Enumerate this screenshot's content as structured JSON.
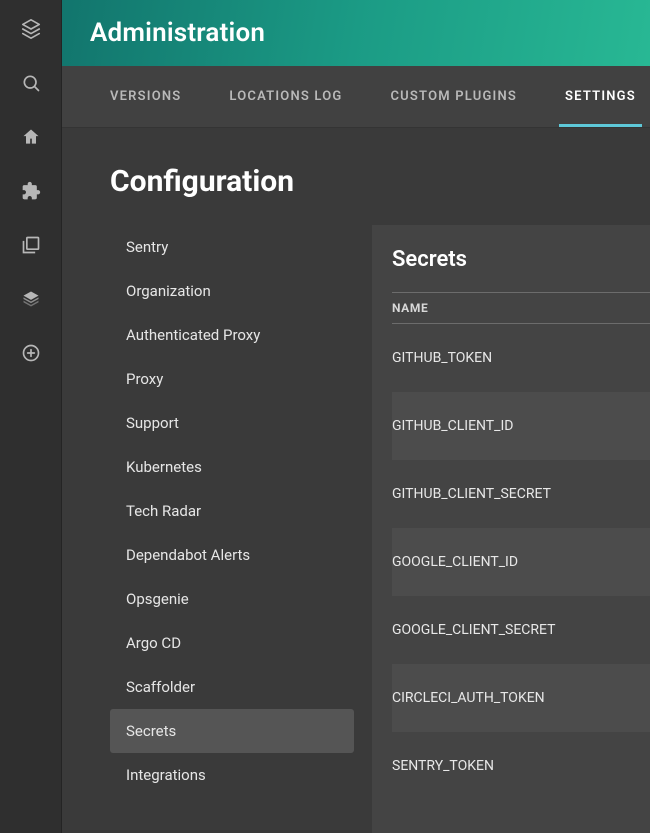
{
  "header": {
    "title": "Administration"
  },
  "tabs": [
    {
      "label": "VERSIONS",
      "active": false
    },
    {
      "label": "LOCATIONS LOG",
      "active": false
    },
    {
      "label": "CUSTOM PLUGINS",
      "active": false
    },
    {
      "label": "SETTINGS",
      "active": true
    }
  ],
  "page": {
    "title": "Configuration"
  },
  "sidenav": {
    "items": [
      {
        "label": "Sentry",
        "selected": false
      },
      {
        "label": "Organization",
        "selected": false
      },
      {
        "label": "Authenticated Proxy",
        "selected": false
      },
      {
        "label": "Proxy",
        "selected": false
      },
      {
        "label": "Support",
        "selected": false
      },
      {
        "label": "Kubernetes",
        "selected": false
      },
      {
        "label": "Tech Radar",
        "selected": false
      },
      {
        "label": "Dependabot Alerts",
        "selected": false
      },
      {
        "label": "Opsgenie",
        "selected": false
      },
      {
        "label": "Argo CD",
        "selected": false
      },
      {
        "label": "Scaffolder",
        "selected": false
      },
      {
        "label": "Secrets",
        "selected": true
      },
      {
        "label": "Integrations",
        "selected": false
      }
    ]
  },
  "secrets": {
    "title": "Secrets",
    "columns": {
      "name": "NAME"
    },
    "rows": [
      {
        "name": "GITHUB_TOKEN"
      },
      {
        "name": "GITHUB_CLIENT_ID"
      },
      {
        "name": "GITHUB_CLIENT_SECRET"
      },
      {
        "name": "GOOGLE_CLIENT_ID"
      },
      {
        "name": "GOOGLE_CLIENT_SECRET"
      },
      {
        "name": "CIRCLECI_AUTH_TOKEN"
      },
      {
        "name": "SENTRY_TOKEN"
      }
    ]
  },
  "colors": {
    "accent": "#5ec8d8",
    "headerGradientStart": "#12756d",
    "headerGradientEnd": "#28b894"
  }
}
